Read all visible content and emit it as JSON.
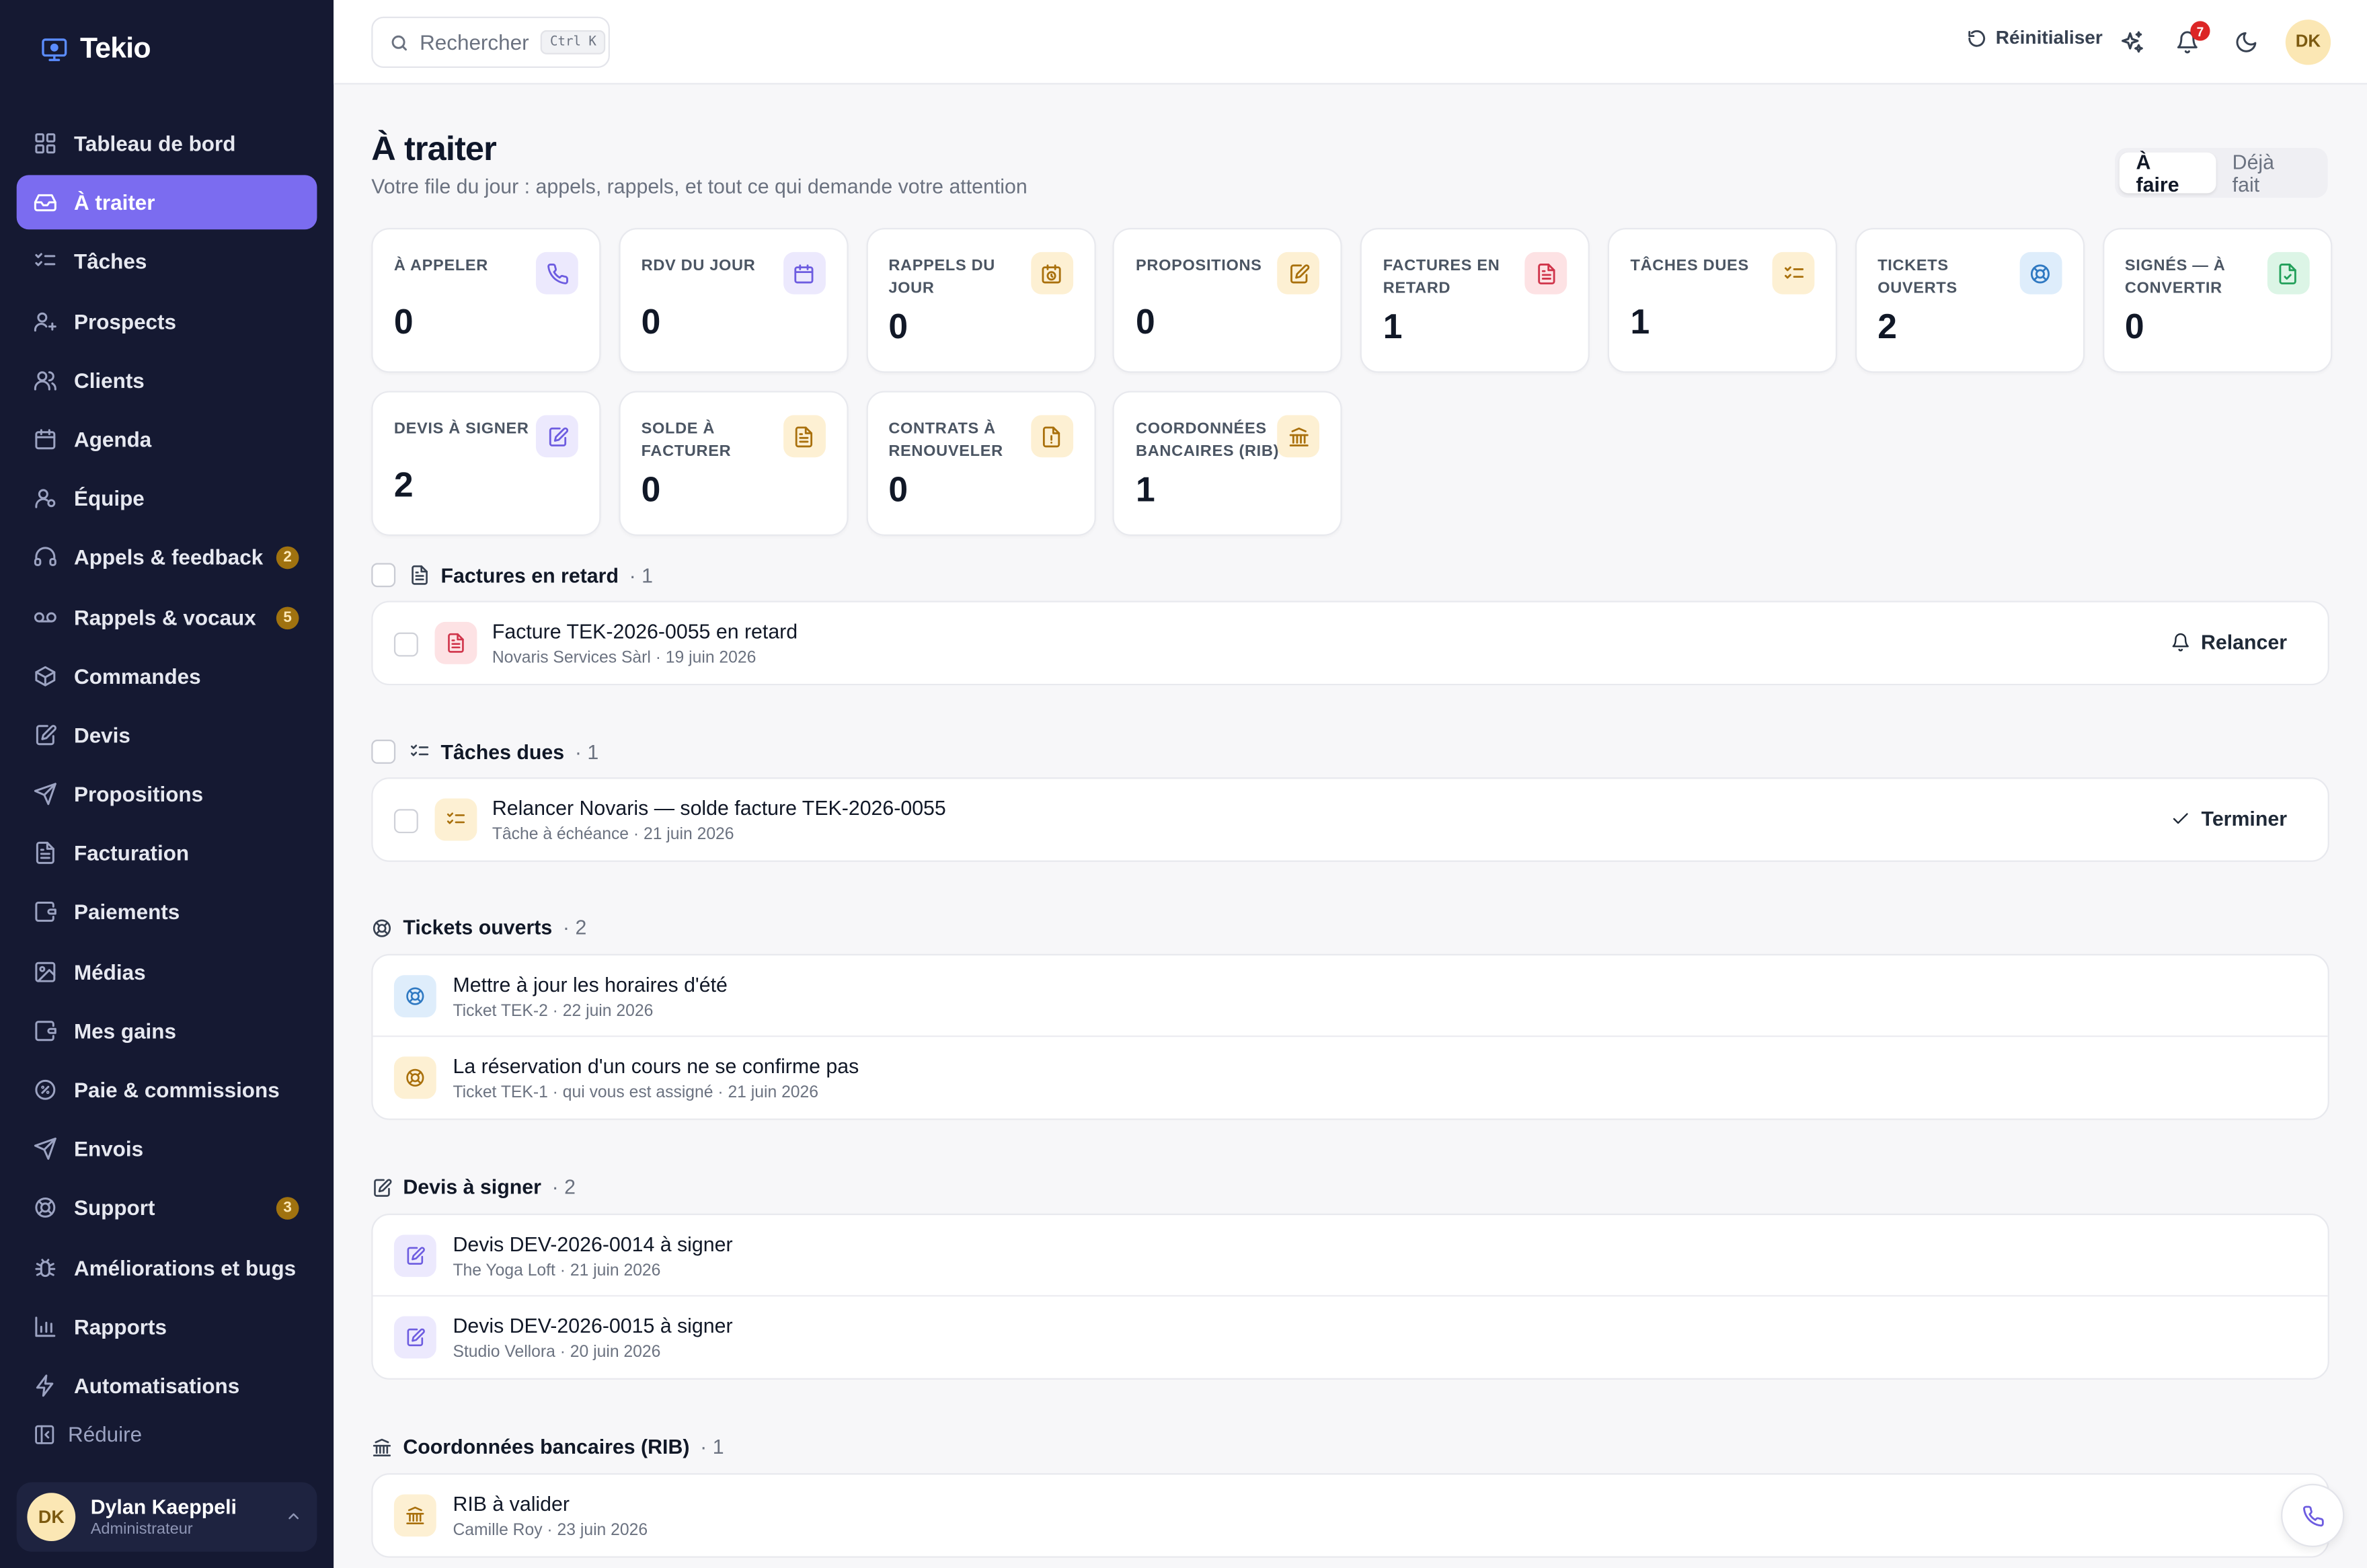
{
  "brand": {
    "name": "Tekio"
  },
  "sidebar": {
    "items": [
      {
        "label": "Tableau de bord",
        "icon": "grid-icon"
      },
      {
        "label": "À traiter",
        "icon": "inbox-icon",
        "active": true
      },
      {
        "label": "Tâches",
        "icon": "checklist-icon"
      },
      {
        "label": "Prospects",
        "icon": "user-plus-icon"
      },
      {
        "label": "Clients",
        "icon": "users-icon"
      },
      {
        "label": "Agenda",
        "icon": "calendar-icon"
      },
      {
        "label": "Équipe",
        "icon": "team-icon"
      },
      {
        "label": "Appels & feedback",
        "icon": "headset-icon",
        "badge": "2"
      },
      {
        "label": "Rappels & vocaux",
        "icon": "voicemail-icon",
        "badge": "5"
      },
      {
        "label": "Commandes",
        "icon": "box-icon"
      },
      {
        "label": "Devis",
        "icon": "edit-doc-icon"
      },
      {
        "label": "Propositions",
        "icon": "send-icon"
      },
      {
        "label": "Facturation",
        "icon": "invoice-icon"
      },
      {
        "label": "Paiements",
        "icon": "wallet-icon"
      },
      {
        "label": "Médias",
        "icon": "image-icon"
      },
      {
        "label": "Mes gains",
        "icon": "wallet-icon"
      },
      {
        "label": "Paie & commissions",
        "icon": "percent-icon"
      },
      {
        "label": "Envois",
        "icon": "send-icon"
      },
      {
        "label": "Support",
        "icon": "lifebuoy-icon",
        "badge": "3"
      },
      {
        "label": "Améliorations et bugs",
        "icon": "bug-icon"
      },
      {
        "label": "Rapports",
        "icon": "bar-chart-icon"
      },
      {
        "label": "Automatisations",
        "icon": "bolt-icon"
      }
    ],
    "collapse_label": "Réduire",
    "user": {
      "initials": "DK",
      "name": "Dylan Kaeppeli",
      "role": "Administrateur"
    }
  },
  "topbar": {
    "search_placeholder": "Rechercher",
    "search_kbd": "Ctrl K",
    "reset_label": "Réinitialiser",
    "notif_count": "7",
    "avatar_initials": "DK"
  },
  "page": {
    "title": "À traiter",
    "subtitle": "Votre file du jour : appels, rappels, et tout ce qui demande votre attention",
    "tabs": [
      {
        "label": "À faire",
        "active": true
      },
      {
        "label": "Déjà fait"
      }
    ]
  },
  "cards": [
    {
      "label": "À appeler",
      "value": "0",
      "icon": "phone-icon",
      "tone": "violet"
    },
    {
      "label": "RDV du jour",
      "value": "0",
      "icon": "calendar-icon",
      "tone": "violet"
    },
    {
      "label": "Rappels du jour",
      "value": "0",
      "icon": "calendar-clock-icon",
      "tone": "amber"
    },
    {
      "label": "Propositions",
      "value": "0",
      "icon": "edit-doc-icon",
      "tone": "amber"
    },
    {
      "label": "Factures en retard",
      "value": "1",
      "icon": "invoice-icon",
      "tone": "red"
    },
    {
      "label": "Tâches dues",
      "value": "1",
      "icon": "checklist-icon",
      "tone": "amber"
    },
    {
      "label": "Tickets ouverts",
      "value": "2",
      "icon": "lifebuoy-icon",
      "tone": "blue"
    },
    {
      "label": "Signés — à convertir",
      "value": "0",
      "icon": "doc-check-icon",
      "tone": "green"
    },
    {
      "label": "Devis à signer",
      "value": "2",
      "icon": "edit-doc-icon",
      "tone": "violet"
    },
    {
      "label": "Solde à facturer",
      "value": "0",
      "icon": "invoice-icon",
      "tone": "amber"
    },
    {
      "label": "Contrats à renouveler",
      "value": "0",
      "icon": "doc-alert-icon",
      "tone": "amber"
    },
    {
      "label": "Coordonnées bancaires (RIB)",
      "value": "1",
      "icon": "bank-icon",
      "tone": "amber"
    }
  ],
  "sections": [
    {
      "title": "Factures en retard",
      "count": "· 1",
      "icon": "invoice-icon",
      "checkbox": true,
      "rows": [
        {
          "title": "Facture TEK-2026-0055 en retard",
          "sub": "Novaris Services Sàrl · 19 juin 2026",
          "icon": "invoice-icon",
          "tone": "red",
          "action": "Relancer",
          "action_icon": "bell-icon",
          "checkbox": true
        }
      ]
    },
    {
      "title": "Tâches dues",
      "count": "· 1",
      "icon": "checklist-icon",
      "checkbox": true,
      "rows": [
        {
          "title": "Relancer Novaris — solde facture TEK-2026-0055",
          "sub": "Tâche à échéance · 21 juin 2026",
          "icon": "checklist-icon",
          "tone": "amber",
          "action": "Terminer",
          "action_icon": "check-icon",
          "checkbox": true
        }
      ]
    },
    {
      "title": "Tickets ouverts",
      "count": "· 2",
      "icon": "lifebuoy-icon",
      "checkbox": false,
      "rows": [
        {
          "title": "Mettre à jour les horaires d'été",
          "sub": "Ticket TEK-2 · 22 juin 2026",
          "icon": "lifebuoy-icon",
          "tone": "blue"
        },
        {
          "title": "La réservation d'un cours ne se confirme pas",
          "sub": "Ticket TEK-1 · qui vous est assigné · 21 juin 2026",
          "icon": "lifebuoy-icon",
          "tone": "amber"
        }
      ]
    },
    {
      "title": "Devis à signer",
      "count": "· 2",
      "icon": "edit-doc-icon",
      "checkbox": false,
      "rows": [
        {
          "title": "Devis DEV-2026-0014 à signer",
          "sub": "The Yoga Loft · 21 juin 2026",
          "icon": "edit-doc-icon",
          "tone": "violet"
        },
        {
          "title": "Devis DEV-2026-0015 à signer",
          "sub": "Studio Vellora · 20 juin 2026",
          "icon": "edit-doc-icon",
          "tone": "violet"
        }
      ]
    },
    {
      "title": "Coordonnées bancaires (RIB)",
      "count": "· 1",
      "icon": "bank-icon",
      "checkbox": false,
      "rows": [
        {
          "title": "RIB à valider",
          "sub": "Camille Roy · 23 juin 2026",
          "icon": "bank-icon",
          "tone": "amber"
        }
      ]
    }
  ],
  "colors": {
    "accent": "#7b6cf0",
    "sidebar_bg": "#151932",
    "badge": "#a0720f",
    "notif": "#dc2626"
  }
}
